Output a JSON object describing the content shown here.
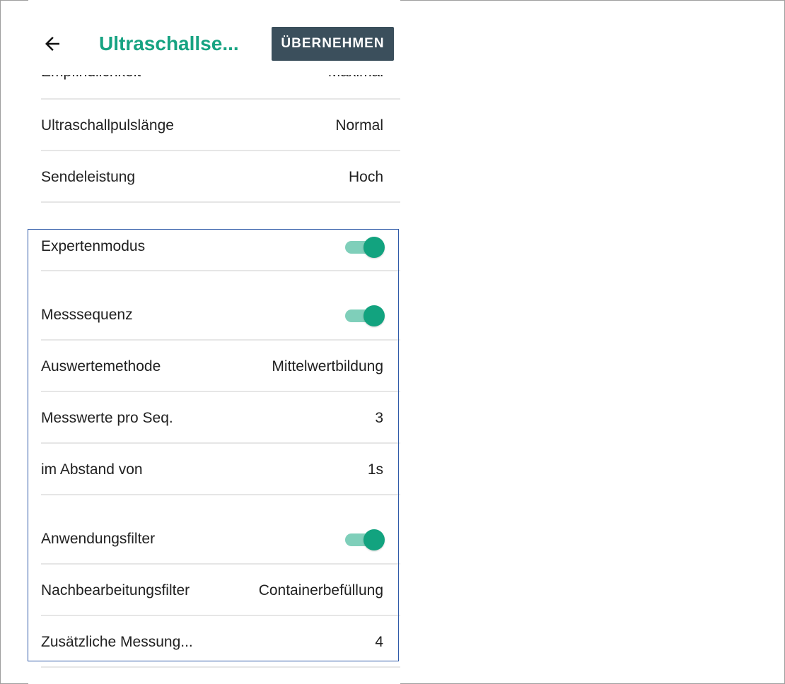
{
  "header": {
    "title": "Ultraschallse...",
    "apply_label": "ÜBERNEHMEN"
  },
  "settings": {
    "cut_item": {
      "label": "Empfindlichkeit",
      "value": "Maximal"
    },
    "pulse_length": {
      "label": "Ultraschallpulslänge",
      "value": "Normal"
    },
    "transmit_power": {
      "label": "Sendeleistung",
      "value": "Hoch"
    },
    "expert_mode": {
      "label": "Expertenmodus",
      "on": true
    },
    "measure_sequence": {
      "label": "Messsequenz",
      "on": true
    },
    "eval_method": {
      "label": "Auswertemethode",
      "value": "Mittelwertbildung"
    },
    "values_per_seq": {
      "label": "Messwerte pro Seq.",
      "value": "3"
    },
    "interval": {
      "label": "im Abstand von",
      "value": "1s"
    },
    "app_filter": {
      "label": "Anwendungsfilter",
      "on": true
    },
    "post_filter": {
      "label": "Nachbearbeitungsfilter",
      "value": "Containerbefüllung"
    },
    "additional_measure": {
      "label": "Zusätzliche Messung...",
      "value": "4"
    }
  },
  "colors": {
    "accent": "#17a382",
    "toggle_knob": "#12a37f",
    "toggle_track": "#7fcfba",
    "button_bg": "#3b4f5c",
    "highlight_border": "#2f5aa8"
  },
  "icons": {
    "back": "arrow-left-icon"
  }
}
